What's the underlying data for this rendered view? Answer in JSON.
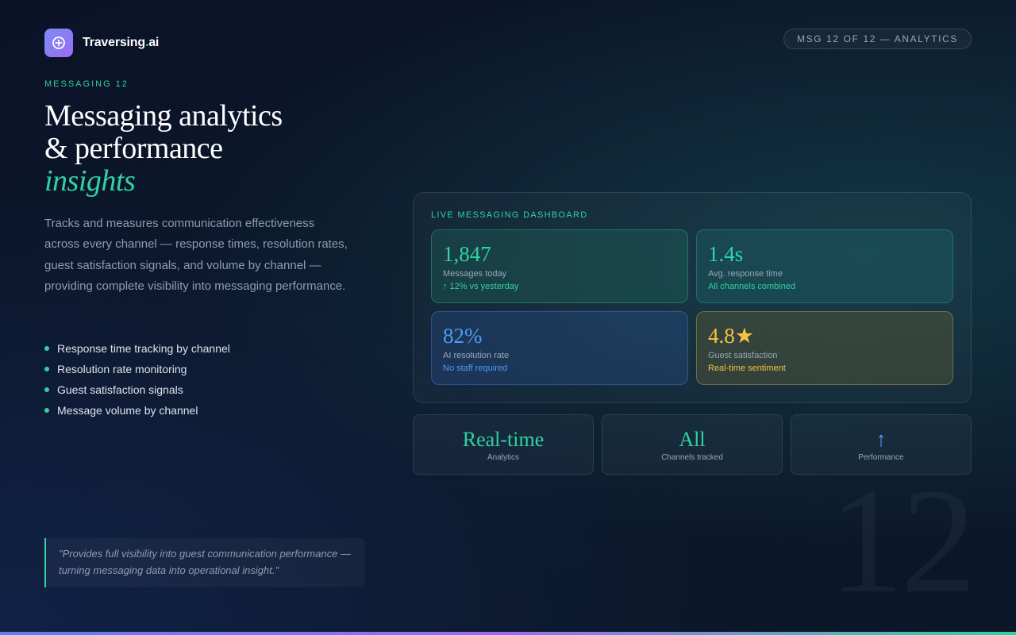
{
  "brand": {
    "name": "Traversing",
    "dot": ".",
    "suffix": "ai",
    "logo_icon": "plus-circle-icon"
  },
  "header": {
    "pill": "MSG 12 OF 12 — ANALYTICS"
  },
  "hero": {
    "eyebrow": "MESSAGING 12",
    "title_line1": "Messaging analytics",
    "title_line2": "& performance",
    "title_accent": "insights",
    "description": "Tracks and measures communication effectiveness across every channel — response times, resolution rates, guest satisfaction signals, and volume by channel — providing complete visibility into messaging performance."
  },
  "features": [
    "Response time tracking by channel",
    "Resolution rate monitoring",
    "Guest satisfaction signals",
    "Message volume by channel"
  ],
  "quote": "\"Provides full visibility into guest communication performance — turning messaging data into operational insight.\"",
  "watermark": "12",
  "dashboard": {
    "title": "LIVE MESSAGING DASHBOARD",
    "cards": [
      {
        "value": "1,847",
        "label": "Messages today",
        "sub": "↑ 12% vs yesterday",
        "color": "#2ed3a0"
      },
      {
        "value": "1.4s",
        "label": "Avg. response time",
        "sub": "All channels combined",
        "color": "#2ed3c0"
      },
      {
        "value": "82%",
        "label": "AI resolution rate",
        "sub": "No staff required",
        "color": "#4d9cf5"
      },
      {
        "value": "4.8★",
        "label": "Guest satisfaction",
        "sub": "Real-time sentiment",
        "color": "#f5c344"
      }
    ]
  },
  "stats": [
    {
      "value": "Real-time",
      "caption": "Analytics"
    },
    {
      "value": "All",
      "caption": "Channels tracked"
    },
    {
      "value": "↑",
      "caption": "Performance"
    }
  ]
}
